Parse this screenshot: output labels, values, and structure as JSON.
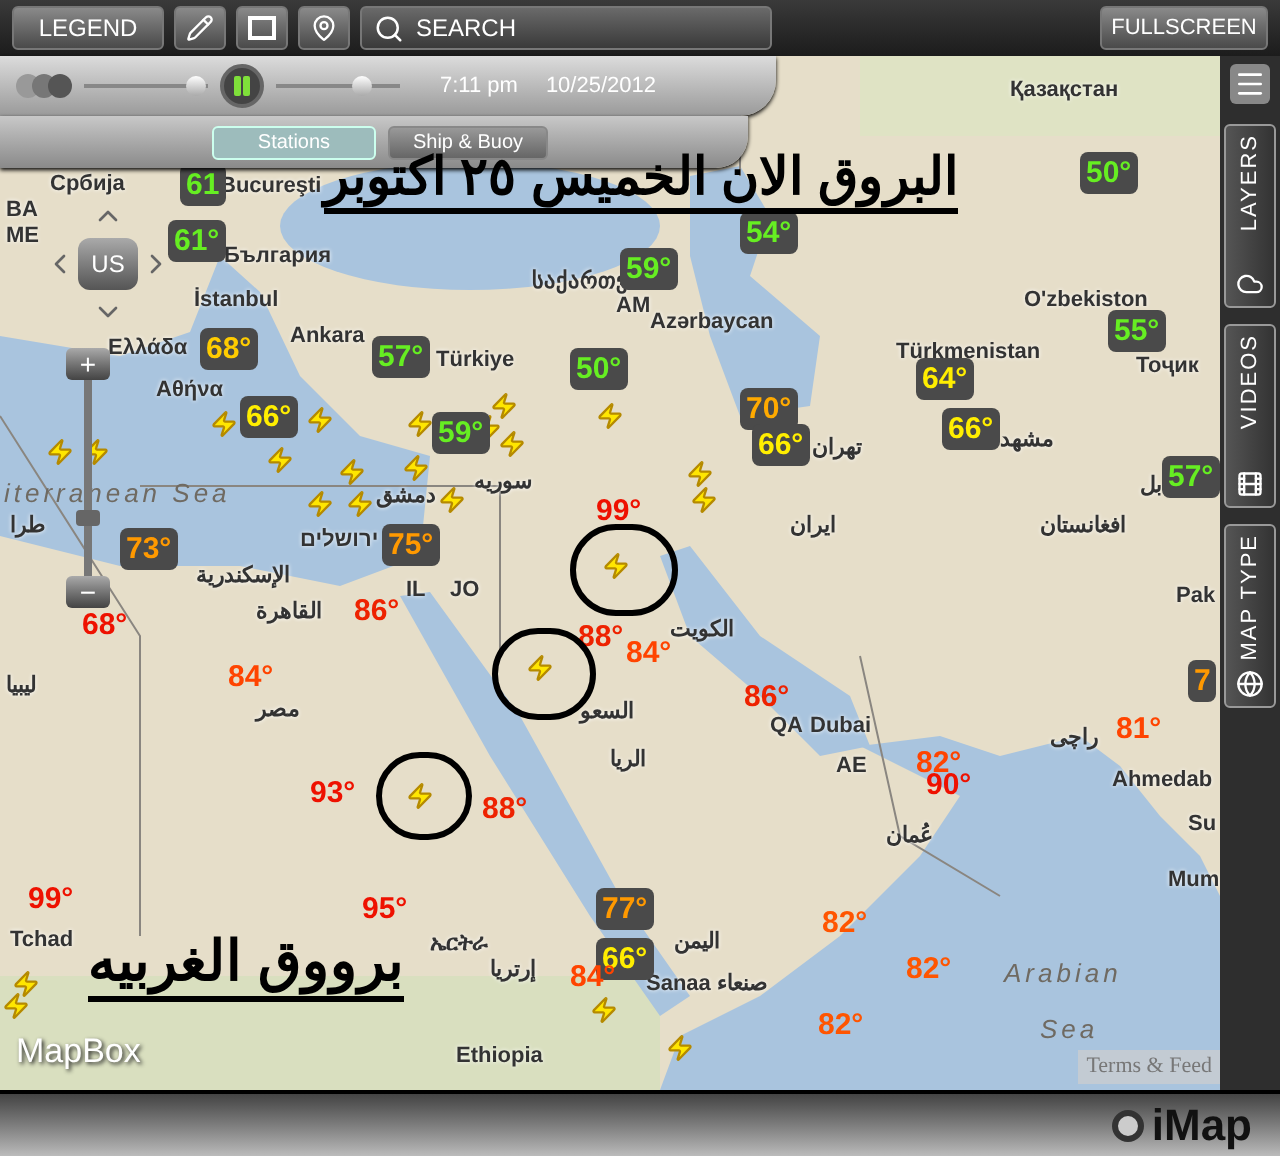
{
  "toolbar": {
    "legend": "LEGEND",
    "search": {
      "placeholder": "SEARCH"
    },
    "fullscreen": "FULLSCREEN"
  },
  "playback": {
    "playing": true,
    "speed": {
      "level": 0.9
    },
    "progress": {
      "level": 0.7
    },
    "time": "7:11 pm",
    "date": "10/25/2012",
    "tabs": [
      {
        "label": "Stations",
        "selected": true
      },
      {
        "label": "Ship & Buoy",
        "selected": false
      }
    ]
  },
  "sidebar": {
    "tabs": [
      {
        "label": "LAYERS",
        "kind": "cloud"
      },
      {
        "label": "VIDEOS",
        "kind": "film"
      },
      {
        "label": "MAP TYPE",
        "kind": "globe"
      }
    ]
  },
  "map": {
    "pan_label": "US",
    "zoom": {
      "in_label": "+",
      "out_label": "−",
      "level": 0.3
    },
    "title": "البروق الان الخميس ٢٥ اكتوبر",
    "caption": "برووق الغربيه",
    "places": [
      {
        "text": "Қазақстан"
      },
      {
        "text": "Bucureşti"
      },
      {
        "text": "Србија"
      },
      {
        "text": "BA"
      },
      {
        "text": "ME"
      },
      {
        "text": "България"
      },
      {
        "text": "საქართვ"
      },
      {
        "text": "İstanbul"
      },
      {
        "text": "AM"
      },
      {
        "text": "O'zbekiston"
      },
      {
        "text": "Azərbaycan"
      },
      {
        "text": "Ankara"
      },
      {
        "text": "Ελλάδα"
      },
      {
        "text": "Türkmenistan"
      },
      {
        "text": "Türkiye"
      },
      {
        "text": "Тоҷик"
      },
      {
        "text": "Αθήνα"
      },
      {
        "text": "مشهد"
      },
      {
        "text": "تهران"
      },
      {
        "text": "iterranean Sea",
        "kind": "sea"
      },
      {
        "text": "دمشق"
      },
      {
        "text": "سوريه"
      },
      {
        "text": "بل"
      },
      {
        "text": "طرا"
      },
      {
        "text": "ایران"
      },
      {
        "text": "افغانستان"
      },
      {
        "text": "ירושלים"
      },
      {
        "text": "الإسكندرية"
      },
      {
        "text": "IL"
      },
      {
        "text": "JO"
      },
      {
        "text": "Pak"
      },
      {
        "text": "القاهرة"
      },
      {
        "text": "الكويت"
      },
      {
        "text": "ليبيا"
      },
      {
        "text": "مصر"
      },
      {
        "text": "السعو"
      },
      {
        "text": "QA"
      },
      {
        "text": "Dubai"
      },
      {
        "text": "راچی"
      },
      {
        "text": "الريا"
      },
      {
        "text": "AE"
      },
      {
        "text": "Ahmedab"
      },
      {
        "text": "Su"
      },
      {
        "text": "عُمان"
      },
      {
        "text": "Mum"
      },
      {
        "text": "Tchad"
      },
      {
        "text": "ኤርትራ"
      },
      {
        "text": "اليمن"
      },
      {
        "text": "إرتريا"
      },
      {
        "text": "Arabian",
        "kind": "sea"
      },
      {
        "text": "Sanaa صنعاء"
      },
      {
        "text": "Sea",
        "kind": "sea"
      },
      {
        "text": "Ethiopia"
      }
    ],
    "temperatures": [
      {
        "text": "50°",
        "color": "#66ee22"
      },
      {
        "text": "61",
        "color": "#66ee22"
      },
      {
        "text": "54°",
        "color": "#66ee22"
      },
      {
        "text": "61°",
        "color": "#66ee22"
      },
      {
        "text": "59°",
        "color": "#66ee22"
      },
      {
        "text": "55°",
        "color": "#66ee22"
      },
      {
        "text": "68°",
        "color": "#ffcc00"
      },
      {
        "text": "57°",
        "color": "#66ee22"
      },
      {
        "text": "50°",
        "color": "#66ee22"
      },
      {
        "text": "64°",
        "color": "#ffee00"
      },
      {
        "text": "66°",
        "color": "#ffee00"
      },
      {
        "text": "59°",
        "color": "#66ee22"
      },
      {
        "text": "70°",
        "color": "#ffaa00"
      },
      {
        "text": "66°",
        "color": "#ffee00"
      },
      {
        "text": "66°",
        "color": "#ffee00"
      },
      {
        "text": "57°",
        "color": "#66ee22"
      },
      {
        "text": "99°",
        "color": "#ee1100"
      },
      {
        "text": "73°",
        "color": "#ff9900"
      },
      {
        "text": "75°",
        "color": "#ff9900"
      },
      {
        "text": "86°",
        "color": "#ee2200"
      },
      {
        "text": "68°",
        "color": "#ee1100"
      },
      {
        "text": "88°",
        "color": "#ee2200"
      },
      {
        "text": "84°",
        "color": "#ff4400"
      },
      {
        "text": "84°",
        "color": "#ff4400"
      },
      {
        "text": "7",
        "color": "#ff9900"
      },
      {
        "text": "86°",
        "color": "#ee2200"
      },
      {
        "text": "81°",
        "color": "#ff4400"
      },
      {
        "text": "82°",
        "color": "#ff4400"
      },
      {
        "text": "90°",
        "color": "#ee1100"
      },
      {
        "text": "93°",
        "color": "#ee1100"
      },
      {
        "text": "88°",
        "color": "#ee2200"
      },
      {
        "text": "99°",
        "color": "#ee1100"
      },
      {
        "text": "95°",
        "color": "#ee1100"
      },
      {
        "text": "77°",
        "color": "#ff9900"
      },
      {
        "text": "82°",
        "color": "#ff5500"
      },
      {
        "text": "66°",
        "color": "#ffee00"
      },
      {
        "text": "84°",
        "color": "#ff4400"
      },
      {
        "text": "82°",
        "color": "#ff5500"
      },
      {
        "text": "82°",
        "color": "#ff5500"
      }
    ],
    "terms": "Terms & Feed",
    "logo": "MapBox"
  },
  "footer": {
    "logo": "iMap"
  }
}
